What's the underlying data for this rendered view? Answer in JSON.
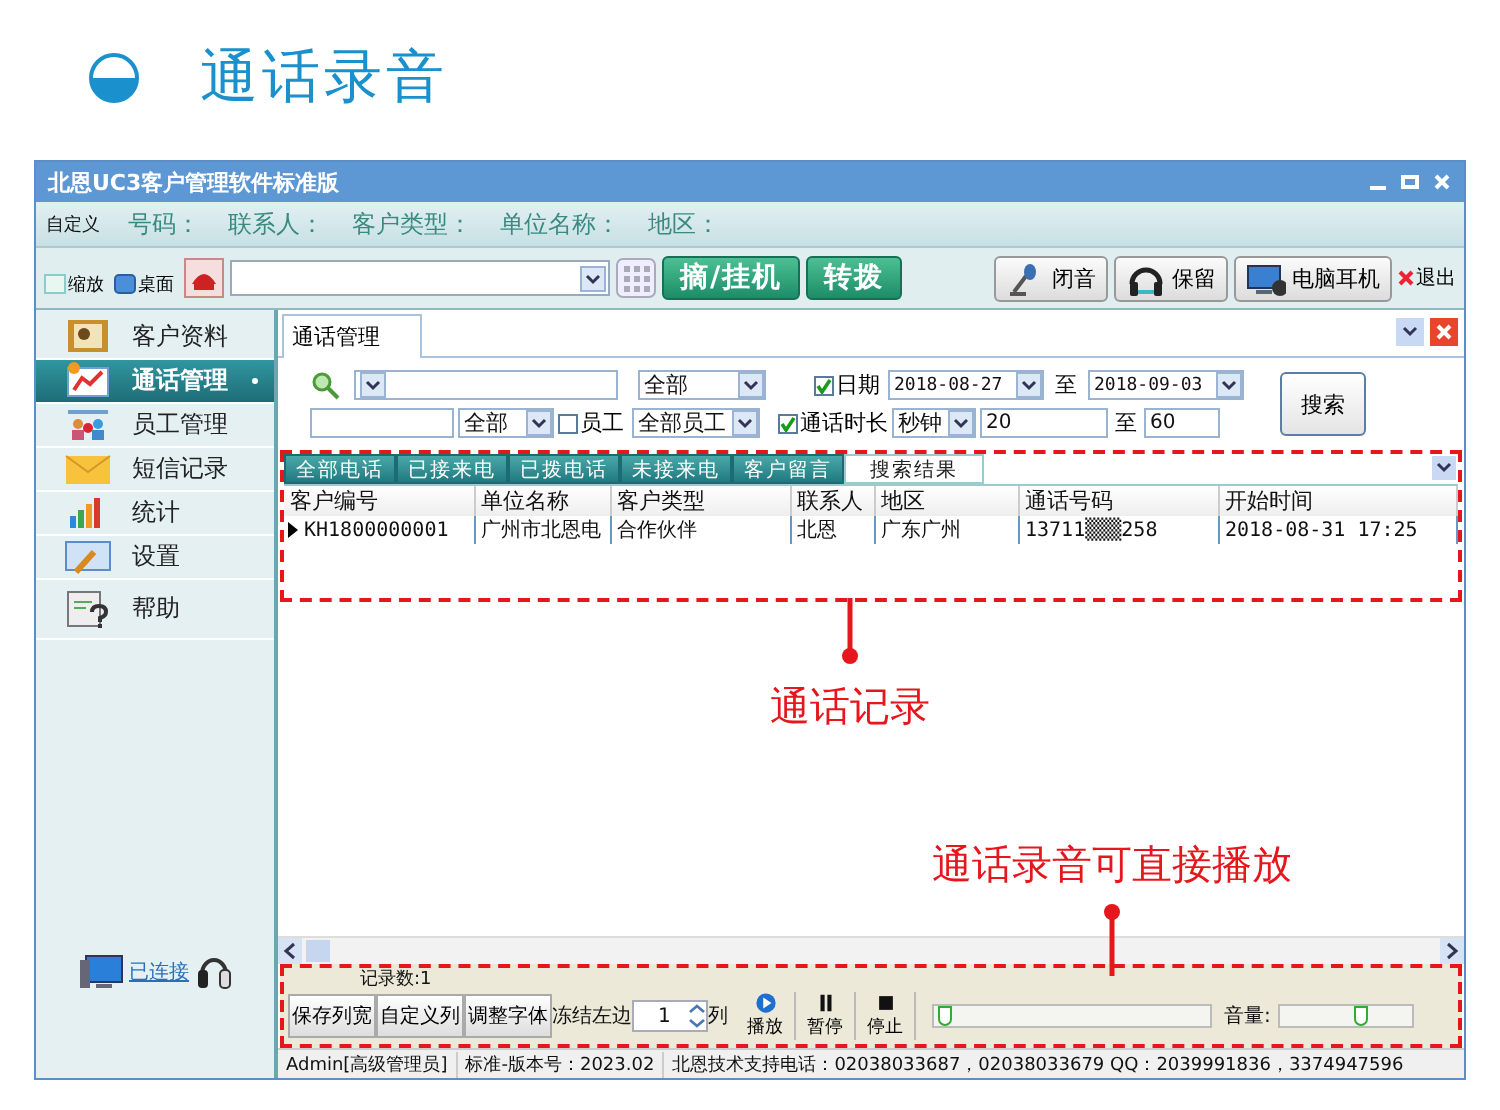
{
  "heading": {
    "title": "通话录音"
  },
  "window": {
    "title": "北恩UC3客户管理软件标准版"
  },
  "query_bar": {
    "label": "自定义",
    "fields": [
      "号码：",
      "联系人：",
      "客户类型：",
      "单位名称：",
      "地区："
    ]
  },
  "toolbar": {
    "toggles": [
      {
        "label": "缩放",
        "kind": "zoom"
      },
      {
        "label": "桌面",
        "kind": "desktop"
      }
    ],
    "buttons": [
      {
        "label": "摘/挂机",
        "kind": "green"
      },
      {
        "label": "转拨",
        "kind": "green"
      },
      {
        "label": "闭音",
        "kind": "mic"
      },
      {
        "label": "保留",
        "kind": "headset"
      },
      {
        "label": "电脑耳机",
        "kind": "pc"
      },
      {
        "label": "退出",
        "kind": "exit"
      }
    ]
  },
  "sidebar": {
    "items": [
      {
        "label": "客户资料",
        "kind": "card",
        "selected": false
      },
      {
        "label": "通话管理",
        "kind": "calls",
        "selected": true
      },
      {
        "label": "员工管理",
        "kind": "staff",
        "selected": false
      },
      {
        "label": "短信记录",
        "kind": "mail",
        "selected": false
      },
      {
        "label": "统计",
        "kind": "stats",
        "selected": false
      },
      {
        "label": "设置",
        "kind": "tools",
        "selected": false
      },
      {
        "label": "帮助",
        "kind": "help",
        "selected": false
      }
    ],
    "connection": "已连接"
  },
  "tabs": [
    {
      "label": "通话管理",
      "selected": true
    }
  ],
  "filters": {
    "row1": [
      {
        "kind": "search"
      },
      {
        "kind": "select",
        "value": "全部"
      },
      {
        "kind": "check",
        "label": "日期",
        "checked": true
      },
      {
        "kind": "date",
        "value": "2018-08-27"
      },
      {
        "kind": "text",
        "value": "至"
      },
      {
        "kind": "date",
        "value": "2018-09-03"
      }
    ],
    "row2": [
      {
        "kind": "input"
      },
      {
        "kind": "select",
        "value": "全部"
      },
      {
        "kind": "check",
        "label": "员工",
        "checked": false
      },
      {
        "kind": "select",
        "value": "全部员工"
      },
      {
        "kind": "check",
        "label": "通话时长",
        "checked": true
      },
      {
        "kind": "select",
        "value": "秒钟"
      },
      {
        "kind": "input",
        "value": "20"
      },
      {
        "kind": "text",
        "value": "至"
      },
      {
        "kind": "input",
        "value": "60"
      }
    ],
    "search_button": "搜索"
  },
  "call_tabs": [
    {
      "label": "全部电话",
      "selected": false
    },
    {
      "label": "已接来电",
      "selected": false
    },
    {
      "label": "已拨电话",
      "selected": false
    },
    {
      "label": "未接来电",
      "selected": false
    },
    {
      "label": "客户留言",
      "selected": false
    },
    {
      "label": "搜索结果",
      "selected": true
    }
  ],
  "table": {
    "columns": [
      "客户编号",
      "单位名称",
      "客户类型",
      "联系人",
      "地区",
      "通话号码",
      "开始时间"
    ],
    "rows": [
      {
        "selected": true,
        "cells": [
          "KH1800000001",
          "广州市北恩电",
          "合作伙伴",
          "北恩",
          "广东广州",
          "13711▒▒▒258",
          "2018-08-31 17:25"
        ]
      }
    ]
  },
  "annotations": [
    {
      "text": "通话记录",
      "kind": "below"
    },
    {
      "text": "通话录音可直接播放",
      "kind": "above"
    }
  ],
  "footer": {
    "record_count": "记录数:1",
    "buttons": [
      "保存列宽",
      "自定义列",
      "调整字体"
    ],
    "freeze_label": "冻结左边",
    "freeze_value": "1",
    "freeze_unit": "列",
    "player": [
      {
        "label": "播放",
        "kind": "play"
      },
      {
        "label": "暂停",
        "kind": "pause"
      },
      {
        "label": "停止",
        "kind": "stop"
      }
    ],
    "progress": {
      "level": 0.01
    },
    "volume_label": "音量:",
    "volume": {
      "level": 0.6
    }
  },
  "status_bar": [
    "Admin[高级管理员]",
    "标准-版本号：2023.02",
    "北恩技术支持电话：02038033687，02038033679 QQ：2039991836，3374947596"
  ]
}
